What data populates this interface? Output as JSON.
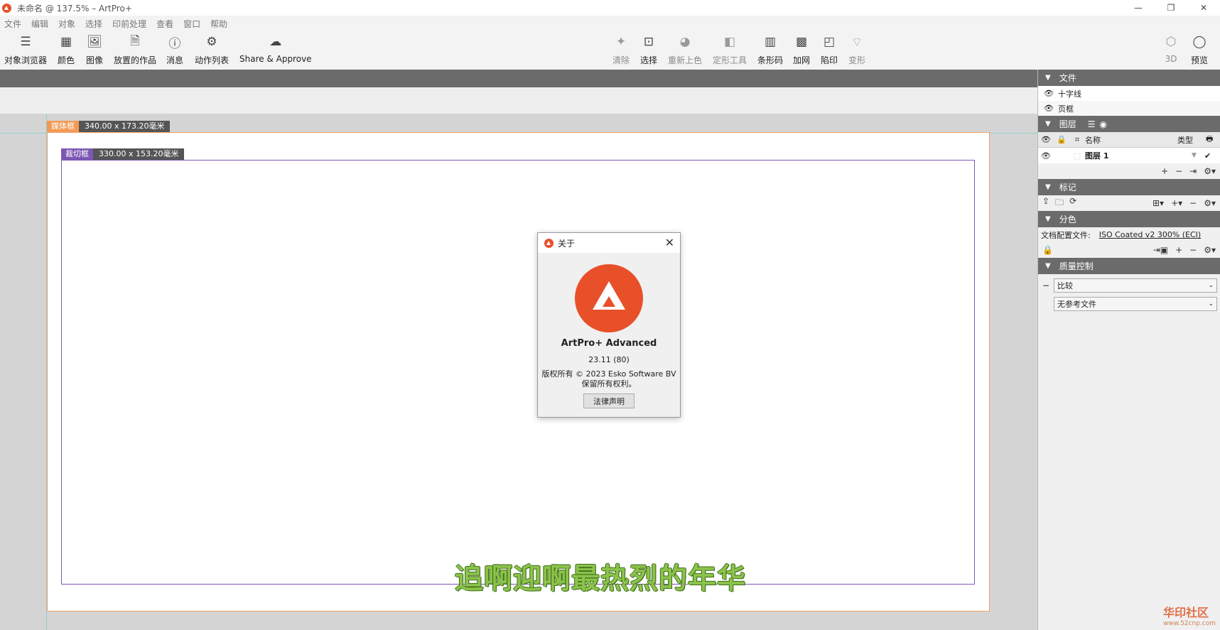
{
  "window": {
    "title": "未命名 @ 137.5% – ArtPro+"
  },
  "menu": [
    "文件",
    "编辑",
    "对象",
    "选择",
    "印前处理",
    "查看",
    "窗口",
    "帮助"
  ],
  "toolbar_left": [
    {
      "label": "对象浏览器",
      "icon": "object-browser-icon",
      "glyph": "☰"
    },
    {
      "label": "颜色",
      "icon": "color-swatches-icon",
      "glyph": "▦"
    },
    {
      "label": "图像",
      "icon": "image-icon",
      "glyph": "🖼"
    },
    {
      "label": "放置的作品",
      "icon": "placed-art-icon",
      "glyph": "🗎"
    },
    {
      "label": "消息",
      "icon": "info-icon",
      "glyph": "ⓘ"
    },
    {
      "label": "动作列表",
      "icon": "action-list-icon",
      "glyph": "⚙"
    },
    {
      "label": "Share & Approve",
      "icon": "cloud-icon",
      "glyph": "☁"
    }
  ],
  "toolbar_right": [
    {
      "label": "清除",
      "icon": "clear-sparkle-icon",
      "glyph": "✦",
      "enabled": false
    },
    {
      "label": "选择",
      "icon": "select-box-icon",
      "glyph": "⊡",
      "enabled": true
    },
    {
      "label": "重新上色",
      "icon": "recolor-palette-icon",
      "glyph": "◕",
      "enabled": false
    },
    {
      "label": "定形工具",
      "icon": "shape-tool-icon",
      "glyph": "◧",
      "enabled": false
    },
    {
      "label": "条形码",
      "icon": "barcode-icon",
      "glyph": "▥",
      "enabled": true
    },
    {
      "label": "加网",
      "icon": "screening-icon",
      "glyph": "▩",
      "enabled": true
    },
    {
      "label": "陷印",
      "icon": "trapping-icon",
      "glyph": "◰",
      "enabled": true
    },
    {
      "label": "变形",
      "icon": "distortion-icon",
      "glyph": "⌔",
      "enabled": false
    },
    {
      "label": "3D",
      "icon": "3d-cube-icon",
      "glyph": "⬡",
      "enabled": false
    },
    {
      "label": "预览",
      "icon": "preview-warning-icon",
      "glyph": "◯",
      "enabled": true
    }
  ],
  "canvas": {
    "media_box": {
      "label": "媒体框",
      "size": "340.00 x 173.20毫米"
    },
    "trim_box": {
      "label": "裁切框",
      "size": "330.00 x 153.20毫米"
    },
    "subtitle": "追啊迎啊最热烈的年华"
  },
  "about": {
    "title": "关于",
    "product": "ArtPro+ Advanced",
    "version": "23.11 (80)",
    "copyright_line1": "版权所有 © 2023 Esko Software BV",
    "copyright_line2": "保留所有权利。",
    "legal_button": "法律声明"
  },
  "panel": {
    "document": {
      "title": "文件",
      "items": [
        "十字线",
        "页框"
      ]
    },
    "layers": {
      "title": "图层",
      "col_name": "名称",
      "col_type": "类型",
      "rows": [
        {
          "name": "图层 1"
        }
      ]
    },
    "marks": {
      "title": "标记"
    },
    "separations": {
      "title": "分色",
      "profile_label": "文档配置文件:",
      "profile_value": "ISO Coated v2 300% (ECI)"
    },
    "quality": {
      "title": "质量控制",
      "compare_value": "比较",
      "reference_value": "无参考文件"
    }
  },
  "watermark": {
    "text": "华印社区",
    "url": "www.52cnp.com"
  },
  "colors": {
    "accent": "#e8502a",
    "media_box": "#f29a55",
    "trim_box": "#7d57b3",
    "panel_header": "#6b6b6b",
    "subtitle": "#8bc34a"
  }
}
